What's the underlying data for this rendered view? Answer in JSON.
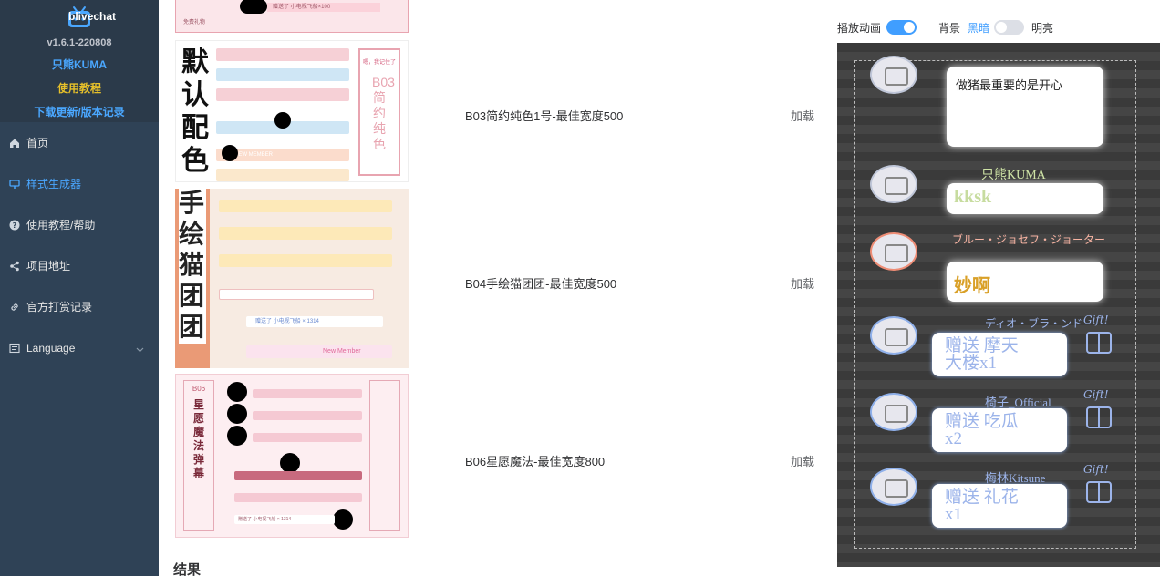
{
  "sidebar": {
    "app_name": "blivechat",
    "version": "v1.6.1-220808",
    "author_link": "只熊KUMA",
    "help_link": "使用教程",
    "download_link": "下载更新/版本记录",
    "menu": [
      {
        "label": "首页",
        "icon": "home-icon"
      },
      {
        "label": "样式生成器",
        "icon": "brush-icon",
        "active": true
      },
      {
        "label": "使用教程/帮助",
        "icon": "question-icon"
      },
      {
        "label": "项目地址",
        "icon": "share-icon"
      },
      {
        "label": "官方打赏记录",
        "icon": "link-icon"
      },
      {
        "label": "Language",
        "icon": "language-icon"
      }
    ]
  },
  "templates": [
    {
      "name": "B03简约纯色1号-最佳宽度500",
      "load_label": "加载",
      "thumb": {
        "big_text": "默认配色",
        "side_text": "B03简约纯色",
        "stamp": "嗯，我记住了",
        "badge": "NEW MEMBER"
      }
    },
    {
      "name": "B04手绘猫团团-最佳宽度500",
      "load_label": "加载",
      "thumb": {
        "big_text": "手绘猫团团",
        "gift_text": "赠送了 小电视飞船 × 1314",
        "badge": "New Member"
      }
    },
    {
      "name": "B06星愿魔法-最佳宽度800",
      "load_label": "加载",
      "thumb": {
        "side_text": "星愿魔法弹幕",
        "corner_text": "B06",
        "gift_text": "赠送了 小电视飞船 × 1314"
      }
    }
  ],
  "top_thumb": {
    "lines": [
      "赠送了 小电视飞船×100",
      "免费礼物"
    ]
  },
  "result_heading": "结果",
  "preview_controls": {
    "animation_label": "播放动画",
    "animation_on": true,
    "background_label": "背景",
    "dark_label": "黑暗",
    "bright_label": "明亮",
    "bright_on": false
  },
  "preview_messages": [
    {
      "author": "",
      "text": "做猪最重要的是开心"
    },
    {
      "author": "只熊KUMA",
      "text": "kksk"
    },
    {
      "author": "ブルー・ジョセフ・ジョーター",
      "text": "妙啊"
    },
    {
      "author": "ディオ・ブラ・ンド",
      "gift": "赠送 摩天大楼x1"
    },
    {
      "author": "椅子_Official",
      "gift": "赠送 吃瓜x2"
    },
    {
      "author": "梅林Kitsune",
      "gift": "赠送 礼花x1"
    }
  ],
  "colors": {
    "sidebar_bg": "#2f4256",
    "accent": "#409eff",
    "help_yellow": "#e6c02a"
  }
}
